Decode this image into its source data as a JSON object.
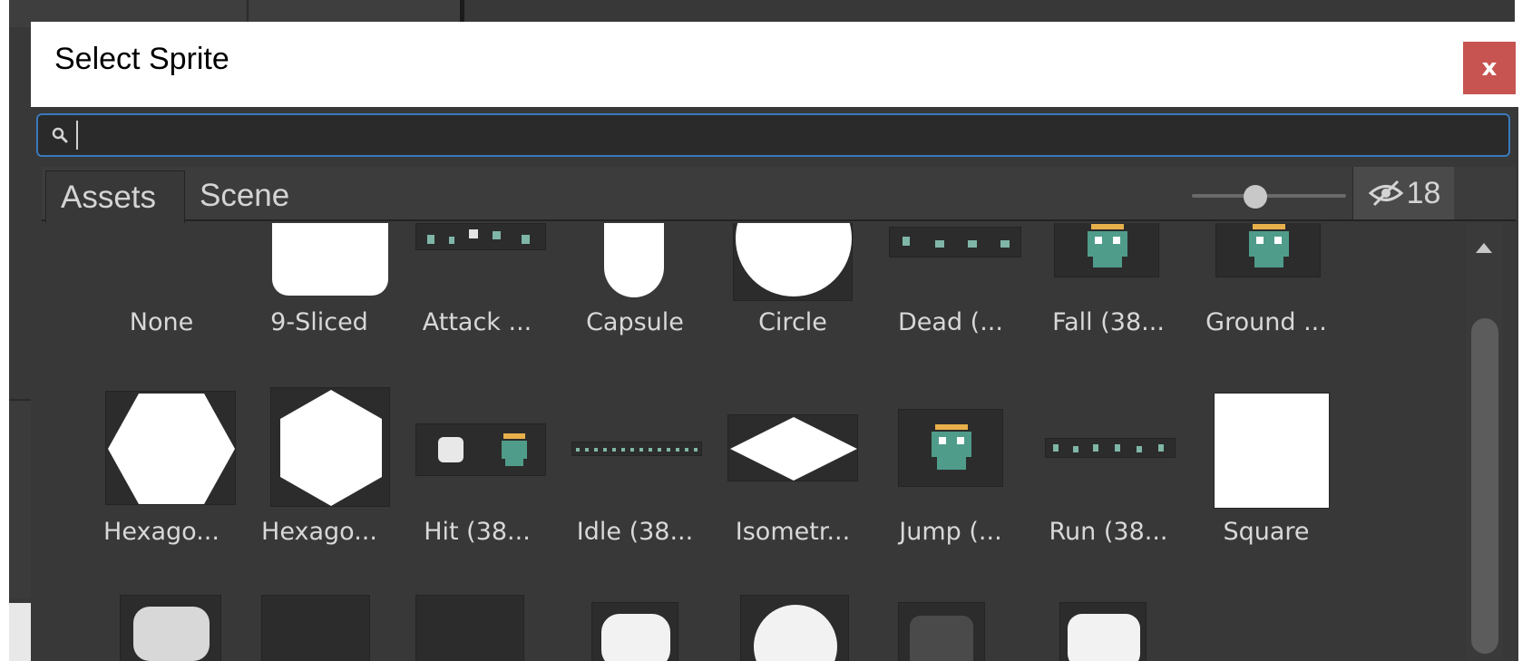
{
  "dialog": {
    "title": "Select Sprite",
    "close_label": "x"
  },
  "search": {
    "value": "",
    "placeholder": ""
  },
  "tabs": [
    {
      "label": "Assets",
      "active": true
    },
    {
      "label": "Scene",
      "active": false
    }
  ],
  "toolbar": {
    "hidden_count": "18"
  },
  "sprites": [
    {
      "label": "None"
    },
    {
      "label": "9-Sliced"
    },
    {
      "label": "Attack ..."
    },
    {
      "label": "Capsule"
    },
    {
      "label": "Circle"
    },
    {
      "label": "Dead (..."
    },
    {
      "label": "Fall (38..."
    },
    {
      "label": "Ground ..."
    },
    {
      "label": "Hexago..."
    },
    {
      "label": "Hexago..."
    },
    {
      "label": "Hit (38..."
    },
    {
      "label": "Idle (38..."
    },
    {
      "label": "Isometr..."
    },
    {
      "label": "Jump (..."
    },
    {
      "label": "Run (38..."
    },
    {
      "label": "Square"
    }
  ],
  "colors": {
    "close_button": "#c75450",
    "search_focus": "#3a79bb",
    "panel_bg": "#383838"
  }
}
